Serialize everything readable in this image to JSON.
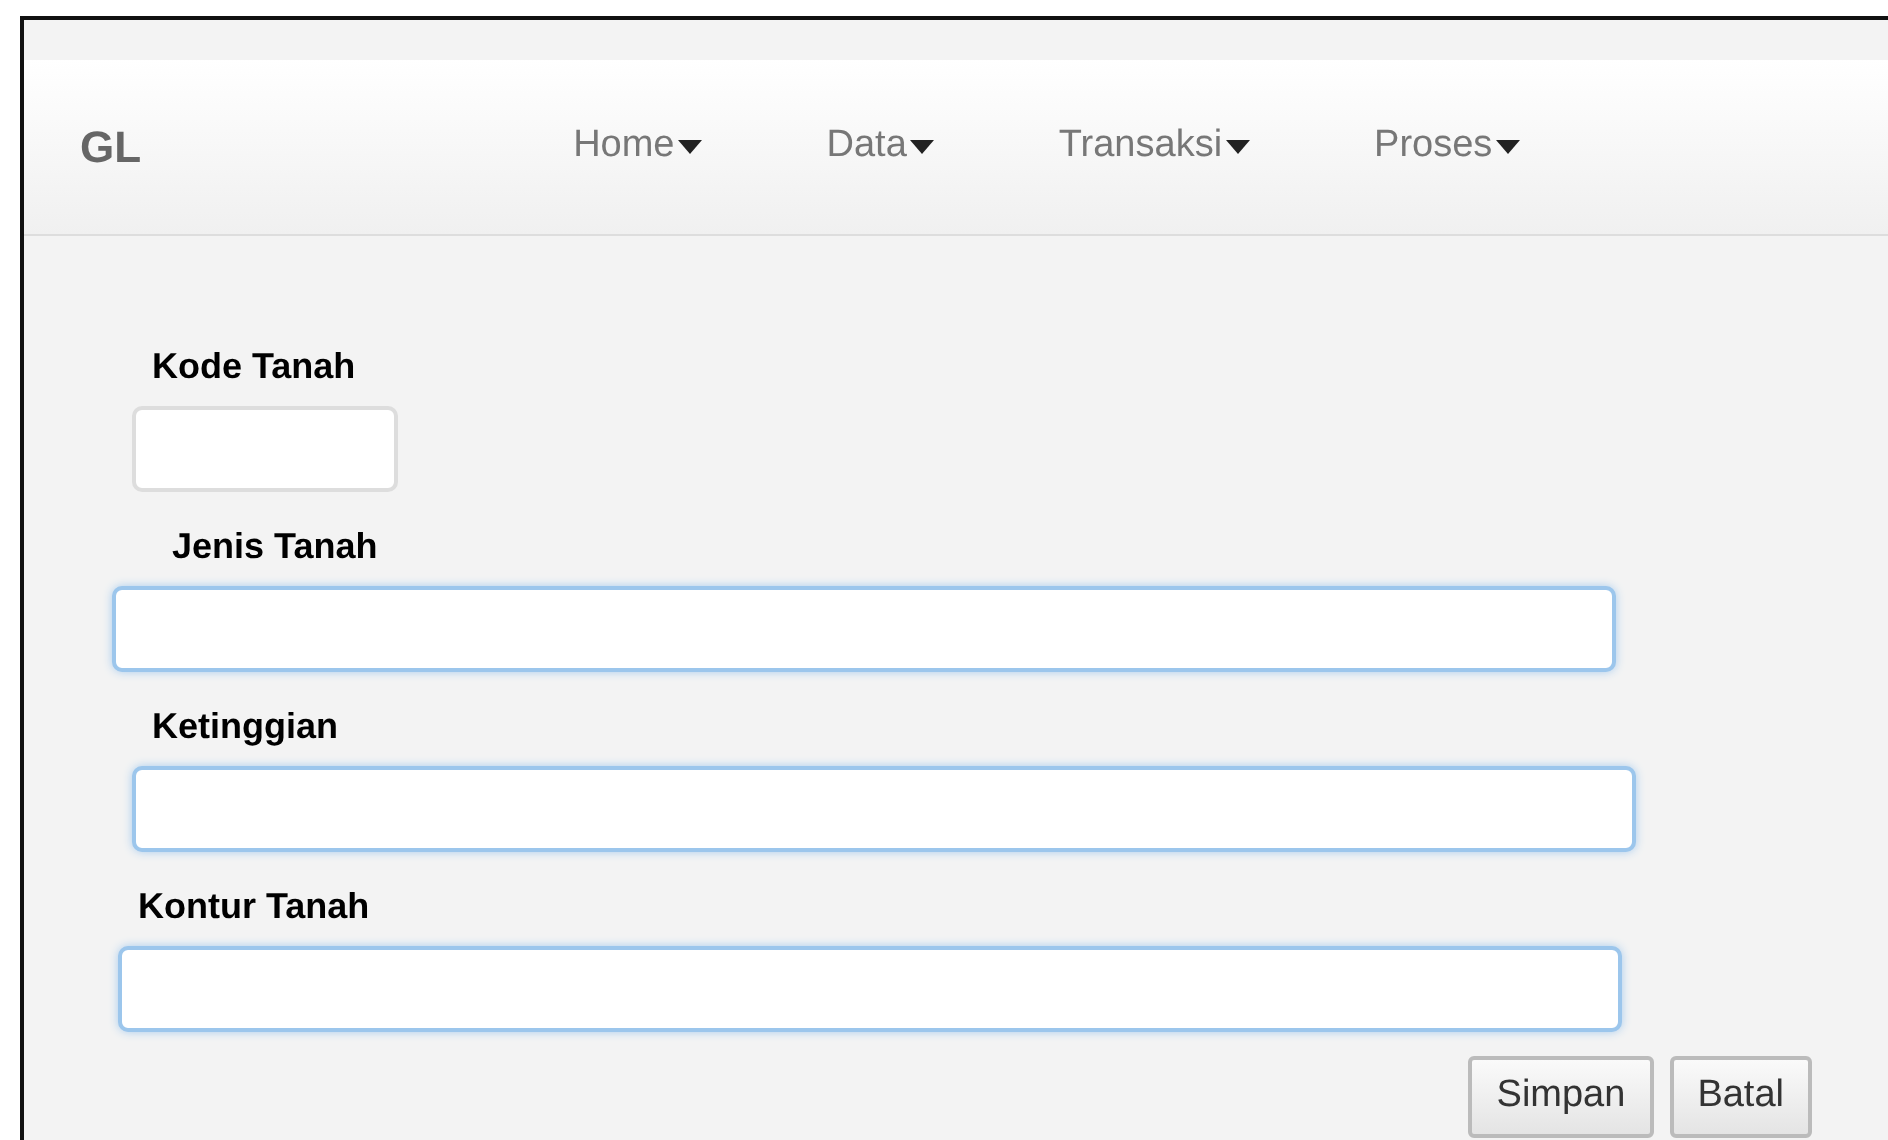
{
  "navbar": {
    "brand": "GL",
    "menus": [
      {
        "label": "Home"
      },
      {
        "label": "Data"
      },
      {
        "label": "Transaksi"
      },
      {
        "label": "Proses"
      }
    ]
  },
  "form": {
    "fields": [
      {
        "label": "Kode Tanah",
        "kind": "short",
        "focused": false
      },
      {
        "label": "Jenis Tanah",
        "kind": "long",
        "focused": true
      },
      {
        "label": "Ketinggian",
        "kind": "long",
        "focused": true
      },
      {
        "label": "Kontur Tanah",
        "kind": "long",
        "focused": true
      }
    ],
    "buttons": [
      "Simpan",
      "Batal"
    ]
  }
}
